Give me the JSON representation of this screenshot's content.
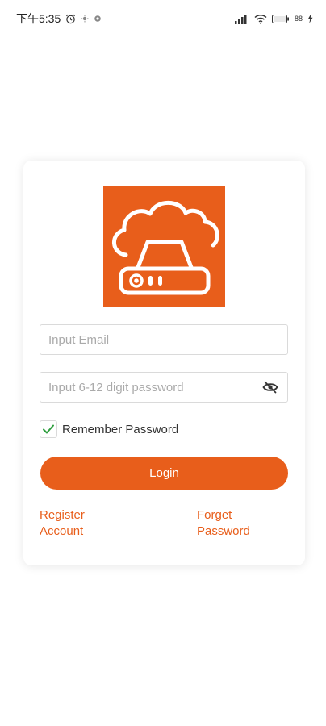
{
  "status_bar": {
    "time": "下午5:35",
    "battery": "88"
  },
  "login": {
    "email_placeholder": "Input Email",
    "password_placeholder": "Input 6-12 digit password",
    "remember_label": "Remember Password",
    "remember_checked": true,
    "login_label": "Login",
    "register_label": "Register\nAccount",
    "forget_label": "Forget\nPassword"
  },
  "colors": {
    "accent": "#e85e1b",
    "check": "#2e9e3e"
  },
  "icons": {
    "logo": "cloud-server-icon",
    "password_toggle": "eye-off-icon",
    "checkbox": "check-icon"
  }
}
